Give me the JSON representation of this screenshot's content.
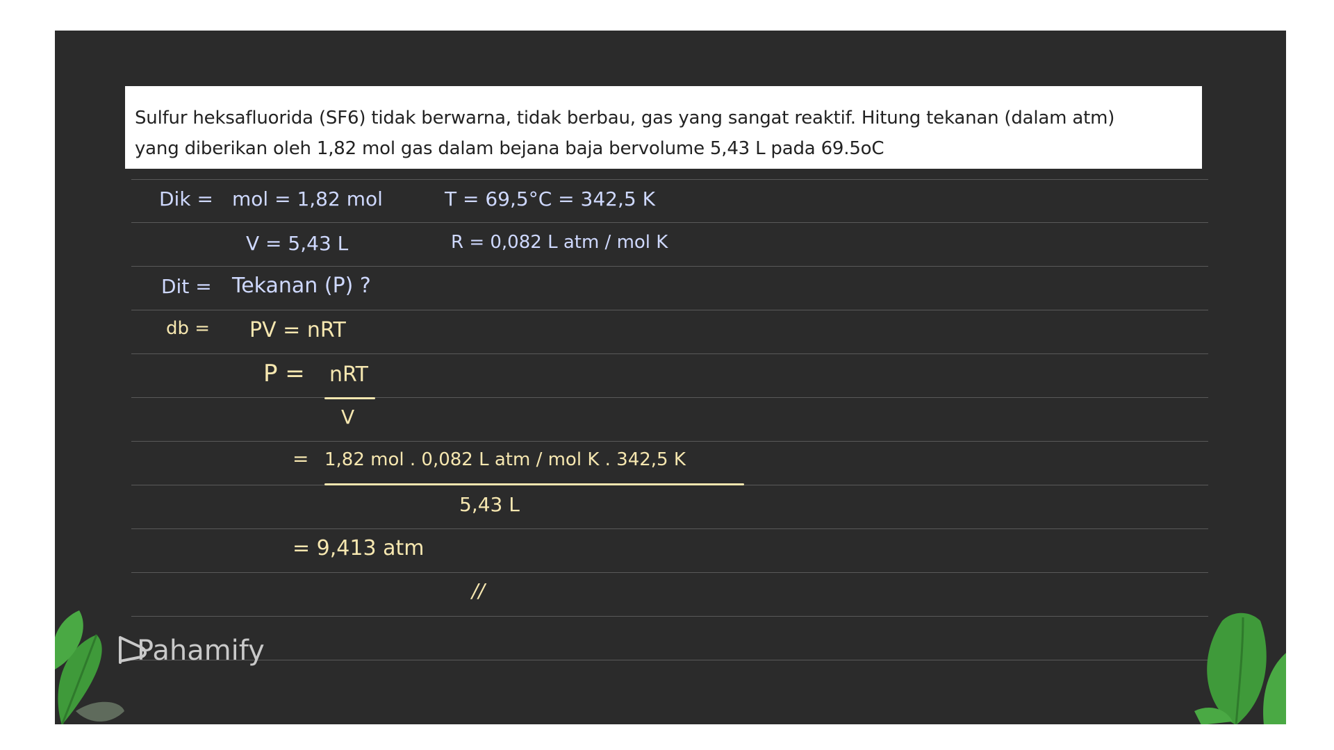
{
  "question": {
    "line1": "Sulfur heksafluorida (SF6) tidak berwarna, tidak berbau, gas yang sangat reaktif. Hitung tekanan (dalam atm)",
    "line2": "yang diberikan oleh 1,82 mol gas dalam bejana baja bervolume 5,43 L pada 69.5oC"
  },
  "work": {
    "dik_label": "Dik =",
    "mol": "mol = 1,82 mol",
    "temp": "T = 69,5°C = 342,5 K",
    "volume": "V = 5,43 L",
    "gas_constant": "R = 0,082 L atm / mol K",
    "dit_label": "Dit =",
    "dit_value": "Tekanan (P) ?",
    "db_label": "db =",
    "eq1": "PV = nRT",
    "eq2_left": "P =",
    "eq2_num": "nRT",
    "eq2_den": "V",
    "eq3_eq": "=",
    "eq3_num": "1,82 mol . 0,082 L atm / mol K . 342,5 K",
    "eq3_den": "5,43 L",
    "eq4": "= 9,413 atm",
    "end_mark": "//"
  },
  "brand": {
    "name": "Pahamify"
  },
  "colors": {
    "board": "#2b2b2b",
    "ink_blue": "#cfd9ff",
    "ink_yellow": "#f6e7b0",
    "leaf": "#3f9a3a"
  }
}
